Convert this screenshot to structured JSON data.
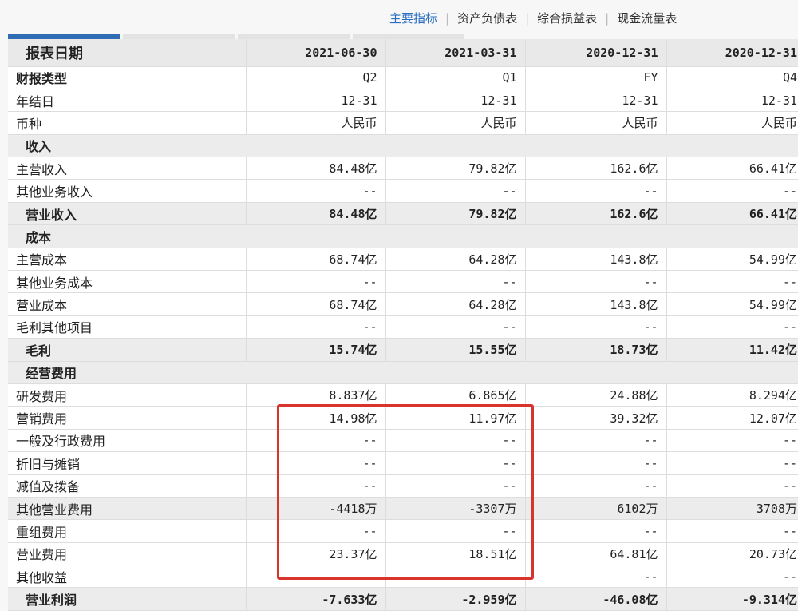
{
  "nav": {
    "items": [
      "主要指标",
      "资产负债表",
      "综合损益表",
      "现金流量表"
    ],
    "active": 0
  },
  "table": {
    "header_label": "报表日期",
    "columns": [
      "2021-06-30",
      "2021-03-31",
      "2020-12-31",
      "2020-12-31"
    ],
    "rows": [
      {
        "label": "财报类型",
        "type": "bold",
        "values": [
          "Q2",
          "Q1",
          "FY",
          "Q4"
        ]
      },
      {
        "label": "年结日",
        "values": [
          "12-31",
          "12-31",
          "12-31",
          "12-31"
        ]
      },
      {
        "label": "币种",
        "values": [
          "人民币",
          "人民币",
          "人民币",
          "人民币"
        ]
      },
      {
        "label": "收入",
        "type": "sec"
      },
      {
        "label": "主营收入",
        "values": [
          "84.48亿",
          "79.82亿",
          "162.6亿",
          "66.41亿"
        ]
      },
      {
        "label": "其他业务收入",
        "values": [
          "--",
          "--",
          "--",
          "--"
        ]
      },
      {
        "label": "营业收入",
        "type": "sum",
        "values": [
          "84.48亿",
          "79.82亿",
          "162.6亿",
          "66.41亿"
        ]
      },
      {
        "label": "成本",
        "type": "sec"
      },
      {
        "label": "主营成本",
        "values": [
          "68.74亿",
          "64.28亿",
          "143.8亿",
          "54.99亿"
        ]
      },
      {
        "label": "其他业务成本",
        "values": [
          "--",
          "--",
          "--",
          "--"
        ]
      },
      {
        "label": "营业成本",
        "values": [
          "68.74亿",
          "64.28亿",
          "143.8亿",
          "54.99亿"
        ]
      },
      {
        "label": "毛利其他项目",
        "values": [
          "--",
          "--",
          "--",
          "--"
        ]
      },
      {
        "label": "毛利",
        "type": "sum",
        "values": [
          "15.74亿",
          "15.55亿",
          "18.73亿",
          "11.42亿"
        ]
      },
      {
        "label": "经营费用",
        "type": "sec"
      },
      {
        "label": "研发费用",
        "values": [
          "8.837亿",
          "6.865亿",
          "24.88亿",
          "8.294亿"
        ]
      },
      {
        "label": "营销费用",
        "values": [
          "14.98亿",
          "11.97亿",
          "39.32亿",
          "12.07亿"
        ]
      },
      {
        "label": "一般及行政费用",
        "values": [
          "--",
          "--",
          "--",
          "--"
        ]
      },
      {
        "label": "折旧与摊销",
        "values": [
          "--",
          "--",
          "--",
          "--"
        ]
      },
      {
        "label": "减值及拨备",
        "values": [
          "--",
          "--",
          "--",
          "--"
        ]
      },
      {
        "label": "其他营业费用",
        "type": "hl",
        "values": [
          "-4418万",
          "-3307万",
          "6102万",
          "3708万"
        ]
      },
      {
        "label": "重组费用",
        "values": [
          "--",
          "--",
          "--",
          "--"
        ]
      },
      {
        "label": "营业费用",
        "values": [
          "23.37亿",
          "18.51亿",
          "64.81亿",
          "20.73亿"
        ]
      },
      {
        "label": "其他收益",
        "values": [
          "--",
          "--",
          "--",
          "--"
        ]
      },
      {
        "label": "营业利润",
        "type": "sum",
        "values": [
          "-7.633亿",
          "-2.959亿",
          "-46.08亿",
          "-9.314亿"
        ]
      }
    ]
  },
  "colors": {
    "accent": "#2f6db5",
    "highlight_box": "#d9342b"
  }
}
